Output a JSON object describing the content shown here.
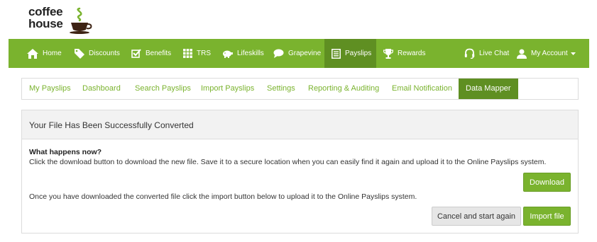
{
  "logo": {
    "line1": "coffee",
    "line2": "house"
  },
  "topnav": {
    "items": [
      {
        "label": "Home",
        "icon": "home-icon"
      },
      {
        "label": "Discounts",
        "icon": "tag-icon"
      },
      {
        "label": "Benefits",
        "icon": "checkbox-icon"
      },
      {
        "label": "TRS",
        "icon": "grid-icon"
      },
      {
        "label": "Lifeskills",
        "icon": "piggy-bank-icon"
      },
      {
        "label": "Grapevine",
        "icon": "chat-bubble-icon"
      },
      {
        "label": "Payslips",
        "icon": "document-list-icon",
        "active": true
      },
      {
        "label": "Rewards",
        "icon": "trophy-icon"
      }
    ],
    "live_chat": "Live Chat",
    "my_account": "My Account"
  },
  "subtabs": [
    {
      "label": "My Payslips"
    },
    {
      "label": "Dashboard"
    },
    {
      "label": "Search Payslips"
    },
    {
      "label": "Import Payslips"
    },
    {
      "label": "Settings"
    },
    {
      "label": "Reporting & Auditing"
    },
    {
      "label": "Email Notification"
    },
    {
      "label": "Data Mapper",
      "active": true
    }
  ],
  "panel": {
    "title": "Your File Has Been Successfully Converted",
    "what_title": "What happens now?",
    "desc1": "Click the download button to download the new file. Save it to a secure location when you can easily find it again and upload it to the Online Payslips system.",
    "download_label": "Download",
    "desc2": "Once you have downloaded the converted file click the import button below to upload it to the Online Payslips system.",
    "cancel_label": "Cancel and start again",
    "import_label": "Import file"
  },
  "colors": {
    "brand_green": "#7ab32e",
    "active_green": "#5f8f22"
  }
}
